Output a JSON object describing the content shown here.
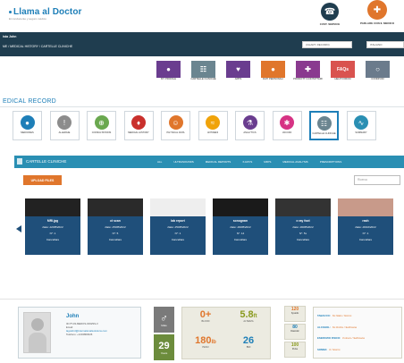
{
  "header": {
    "logo_text": "Llama al Doctor",
    "logo_tagline": "El conducente y seguro médico",
    "cust_service_label": "CUST. SERVICE",
    "call_doctor_label": "PARLARE CON IL MEDICO"
  },
  "nav": {
    "user_name": "ista John",
    "breadcrumb": "ME / MEDICAL HISTORY / CARTELLE CLINICHE",
    "select_view": "(CHART, RECORD)",
    "select_lang": "ITALIANO"
  },
  "top_tiles": [
    {
      "label": "MY PROFILE",
      "icon": "user-icon",
      "color": "#6a3d8f",
      "glyph": "●"
    },
    {
      "label": "CARTELLE CLINICHE",
      "icon": "clipboard-icon",
      "color": "#6b8590",
      "glyph": "☷"
    },
    {
      "label": "APPS",
      "icon": "heart-icon",
      "color": "#6a3d8f",
      "glyph": "♥"
    },
    {
      "label": "DATI PERSONALI",
      "icon": "badge-icon",
      "color": "#e0762c",
      "glyph": "●"
    },
    {
      "label": "PRODOTTI CONTATTAMI",
      "icon": "kit-icon",
      "color": "#8a3a8f",
      "glyph": "✚"
    },
    {
      "label": "HELP FORUM",
      "icon": "faq-icon",
      "color": "#d9534f",
      "glyph": "FAQs"
    },
    {
      "label": "CONDIVIDI",
      "icon": "share-icon",
      "color": "#6b7b8c",
      "glyph": "○"
    }
  ],
  "medical_record": {
    "title": "EDICAL RECORD",
    "items": [
      {
        "label": "MEDICINES",
        "icon": "pill-icon",
        "color": "#1e7fb8",
        "glyph": "●"
      },
      {
        "label": "ALLERGIE",
        "icon": "warning-icon",
        "color": "#8c8c8c",
        "glyph": "!"
      },
      {
        "label": "CONSULTATIONS",
        "icon": "consult-icon",
        "color": "#6aa84f",
        "glyph": "⊕"
      },
      {
        "label": "MEDICAL HISTORY",
        "icon": "people-icon",
        "color": "#c9302c",
        "glyph": "♦"
      },
      {
        "label": "PHYSICAL DATA",
        "icon": "body-icon",
        "color": "#e0762c",
        "glyph": "☺"
      },
      {
        "label": "ANTIDENI",
        "icon": "stethoscope-icon",
        "color": "#f0a30a",
        "glyph": "≈"
      },
      {
        "label": "ANALYTICS",
        "icon": "flask-icon",
        "color": "#6a3d8f",
        "glyph": "⚗"
      },
      {
        "label": "VACCINI",
        "icon": "vaccine-icon",
        "color": "#d63384",
        "glyph": "✱"
      },
      {
        "label": "CARTELLE CLINICHE",
        "icon": "clipboard-icon",
        "color": "#6b8590",
        "glyph": "☷"
      },
      {
        "label": "SUMMARY",
        "icon": "ecg-icon",
        "color": "#2a8fb3",
        "glyph": "∿"
      }
    ]
  },
  "cartelle": {
    "title": "CARTELLE CLINICHE",
    "filters": [
      "ALL",
      "ULTRASOUNDS",
      "MEDICAL REPORTS",
      "X-RAYS",
      "MRI'S",
      "MEDICAL ANALYSIS",
      "PRESCRIPTIONS"
    ],
    "upload_label": "UPLOAD FILES",
    "search_placeholder": "Ricerca"
  },
  "files": [
    {
      "name": "MRI.jpg",
      "date": "Date: 22/08/2014",
      "count": "N°: 1",
      "action": "Cancellare",
      "img": "#222"
    },
    {
      "name": "ct scan",
      "date": "Date: 25/08/2014",
      "count": "N°: 5",
      "action": "Cancellare",
      "img": "#2a2a2a"
    },
    {
      "name": "lab report",
      "date": "Date: 25/08/2014",
      "count": "N°: 1",
      "action": "Cancellare",
      "img": "#eeeeee"
    },
    {
      "name": "sonogram",
      "date": "Date: 26/08/2014",
      "count": "N°: 14",
      "action": "Cancellare",
      "img": "#1a1a1a"
    },
    {
      "name": "x ray foot",
      "date": "Date: 26/08/2014",
      "count": "N°: 5x",
      "action": "Cancellare",
      "img": "#333"
    },
    {
      "name": "rash",
      "date": "Date: 29/10/2014",
      "count": "N°: 1",
      "action": "Cancellare",
      "img": "#c89a8a"
    }
  ],
  "profile": {
    "name": "John",
    "line1": "ID PT-03-MEDOS-0032SS-3",
    "line2": "Email:",
    "line3": "lagosbrd@internationalsolutions.com",
    "line4": "Telefono: +1234800026",
    "gender_symbol": "♂",
    "gender_label": "Male",
    "age": "29",
    "age_label": "Years",
    "blood_value": "0+",
    "blood_label": "BLOOD",
    "height_value": "5.8",
    "height_unit": "ft",
    "height_label": "ALTEZZA",
    "weight_value": "180",
    "weight_unit": "lb",
    "weight_label": "PESO",
    "bmi_value": "26",
    "bmi_label": "BMI",
    "systolic_value": "120",
    "systolic_label": "Systolic",
    "diastolic_value": "80",
    "diastolic_label": "Diastolic",
    "pulse_value": "100",
    "pulse_label": "Pulse"
  },
  "lifestyle": [
    {
      "label": "TABACCO:",
      "value": "No Stato / Giorno"
    },
    {
      "label": "ALCOHOL:",
      "value": "No Drinks / Settimana"
    },
    {
      "label": "ESERCIZIO FISICO:",
      "value": "0 Hours / Settimana"
    },
    {
      "label": "SONNO:",
      "value": "0 / Giorno"
    }
  ]
}
